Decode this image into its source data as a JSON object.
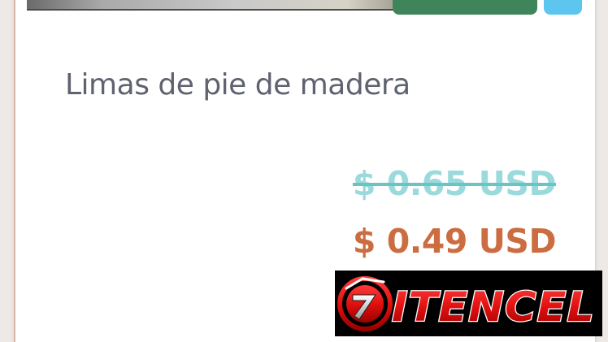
{
  "product": {
    "title": "Limas de pie de madera",
    "old_price": "$ 0.65 USD",
    "new_price": "$ 0.49 USD"
  },
  "watermark": {
    "text": "ITENCEL",
    "icon": "itencel-logo-icon"
  },
  "colors": {
    "cart_button": "#3f845a",
    "wishlist_button": "#5cc6ee",
    "old_price": "#9bdadc",
    "new_price": "#cb6d40",
    "title": "#5f6270"
  }
}
